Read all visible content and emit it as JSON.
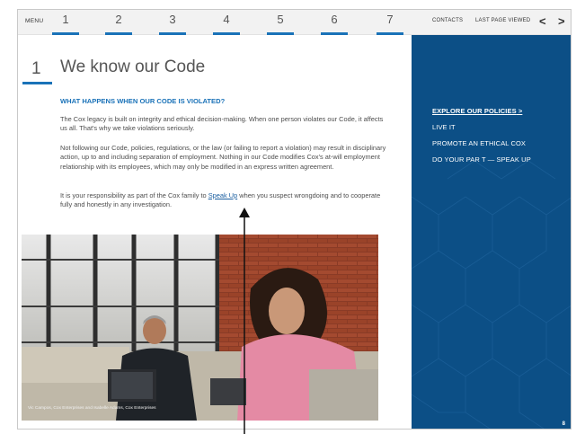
{
  "nav": {
    "menu_label": "MENU",
    "pages": [
      "1",
      "2",
      "3",
      "4",
      "5",
      "6",
      "7"
    ],
    "contacts_label": "CONTACTS",
    "last_page_label": "LAST PAGE VIEWED",
    "prev_arrow": "<",
    "next_arrow": ">"
  },
  "content": {
    "page_number": "1",
    "title": "We know our Code",
    "subheading": "WHAT HAPPENS WHEN OUR CODE IS VIOLATED?",
    "paragraph1": "The Cox legacy is built on integrity and ethical decision-making. When one person violates our Code, it affects us all. That's why we take violations seriously.",
    "paragraph2": "Not following our Code, policies, regulations, or the law (or failing to report a violation) may result in disciplinary action, up to and including separation of employment. Nothing in our Code modifies Cox's at-will employment relationship with its employees, which may only be modified in an express written agreement.",
    "paragraph3_before": "It is your responsibility as part of the Cox family to ",
    "paragraph3_link": "Speak Up",
    "paragraph3_after": " when you suspect wrongdoing and to cooperate fully and honestly in any investigation.",
    "photo_caption": "Vic Campos, Cox Enterprises and Isabelle Adams, Cox Enterprises"
  },
  "panel": {
    "links": [
      {
        "label": "EXPLORE OUR POLICIES",
        "suffix": " >"
      },
      {
        "label": "LIVE IT"
      },
      {
        "label": "PROMOTE AN ETHICAL COX"
      },
      {
        "label": "DO YOUR PAR T — SPEAK UP"
      }
    ],
    "page_corner": "8"
  },
  "colors": {
    "accent_blue": "#1a72b8",
    "panel_blue": "#0c4f86"
  }
}
